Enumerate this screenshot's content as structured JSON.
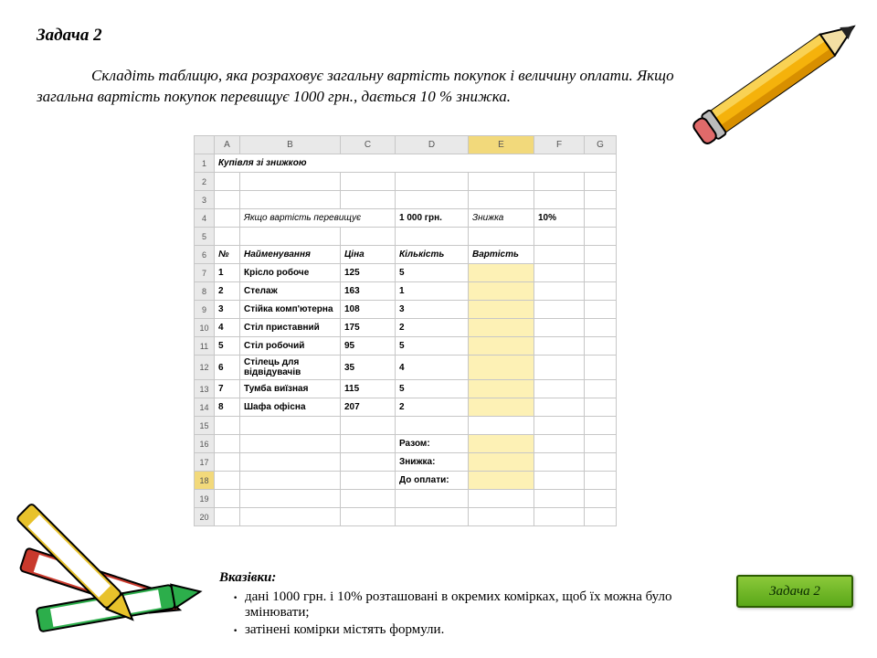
{
  "title": "Задача 2",
  "instruction_part1": "Складіть таблицю, яка розраховує загальну вартість покупок і величину оплати. Якщо",
  "instruction_part2": "загальна вартість покупок перевищує 1000 грн., дається 10 % знижка.",
  "excel": {
    "cols": [
      "A",
      "B",
      "C",
      "D",
      "E",
      "F",
      "G"
    ],
    "title_merged": "Купівля зі знижкою",
    "cond_label": "Якщо вартість перевищує",
    "cond_value": "1 000 грн.",
    "discount_label": "Знижка",
    "discount_value": "10%",
    "headers": {
      "a": "№",
      "b": "Найменування",
      "c": "Ціна",
      "d": "Кількість",
      "e": "Вартість"
    },
    "rows": [
      {
        "n": "1",
        "name": "Крісло робоче",
        "price": "125",
        "qty": "5"
      },
      {
        "n": "2",
        "name": "Стелаж",
        "price": "163",
        "qty": "1"
      },
      {
        "n": "3",
        "name": "Стійка комп'ютерна",
        "price": "108",
        "qty": "3"
      },
      {
        "n": "4",
        "name": "Стіл приставний",
        "price": "175",
        "qty": "2"
      },
      {
        "n": "5",
        "name": "Стіл робочий",
        "price": "95",
        "qty": "5"
      },
      {
        "n": "6",
        "name": "Стілець для відвідувачів",
        "price": "35",
        "qty": "4"
      },
      {
        "n": "7",
        "name": "Тумба виїзная",
        "price": "115",
        "qty": "5"
      },
      {
        "n": "8",
        "name": "Шафа офісна",
        "price": "207",
        "qty": "2"
      }
    ],
    "totals": {
      "total": "Разом:",
      "discount": "Знижка:",
      "topay": "До оплати:"
    }
  },
  "hints": {
    "label": "Вказівки:",
    "items": [
      "дані 1000 грн. і 10% розташовані в окремих комірках, щоб їх можна було змінювати;",
      "затінені комірки містять формули."
    ]
  },
  "button": "Задача 2"
}
